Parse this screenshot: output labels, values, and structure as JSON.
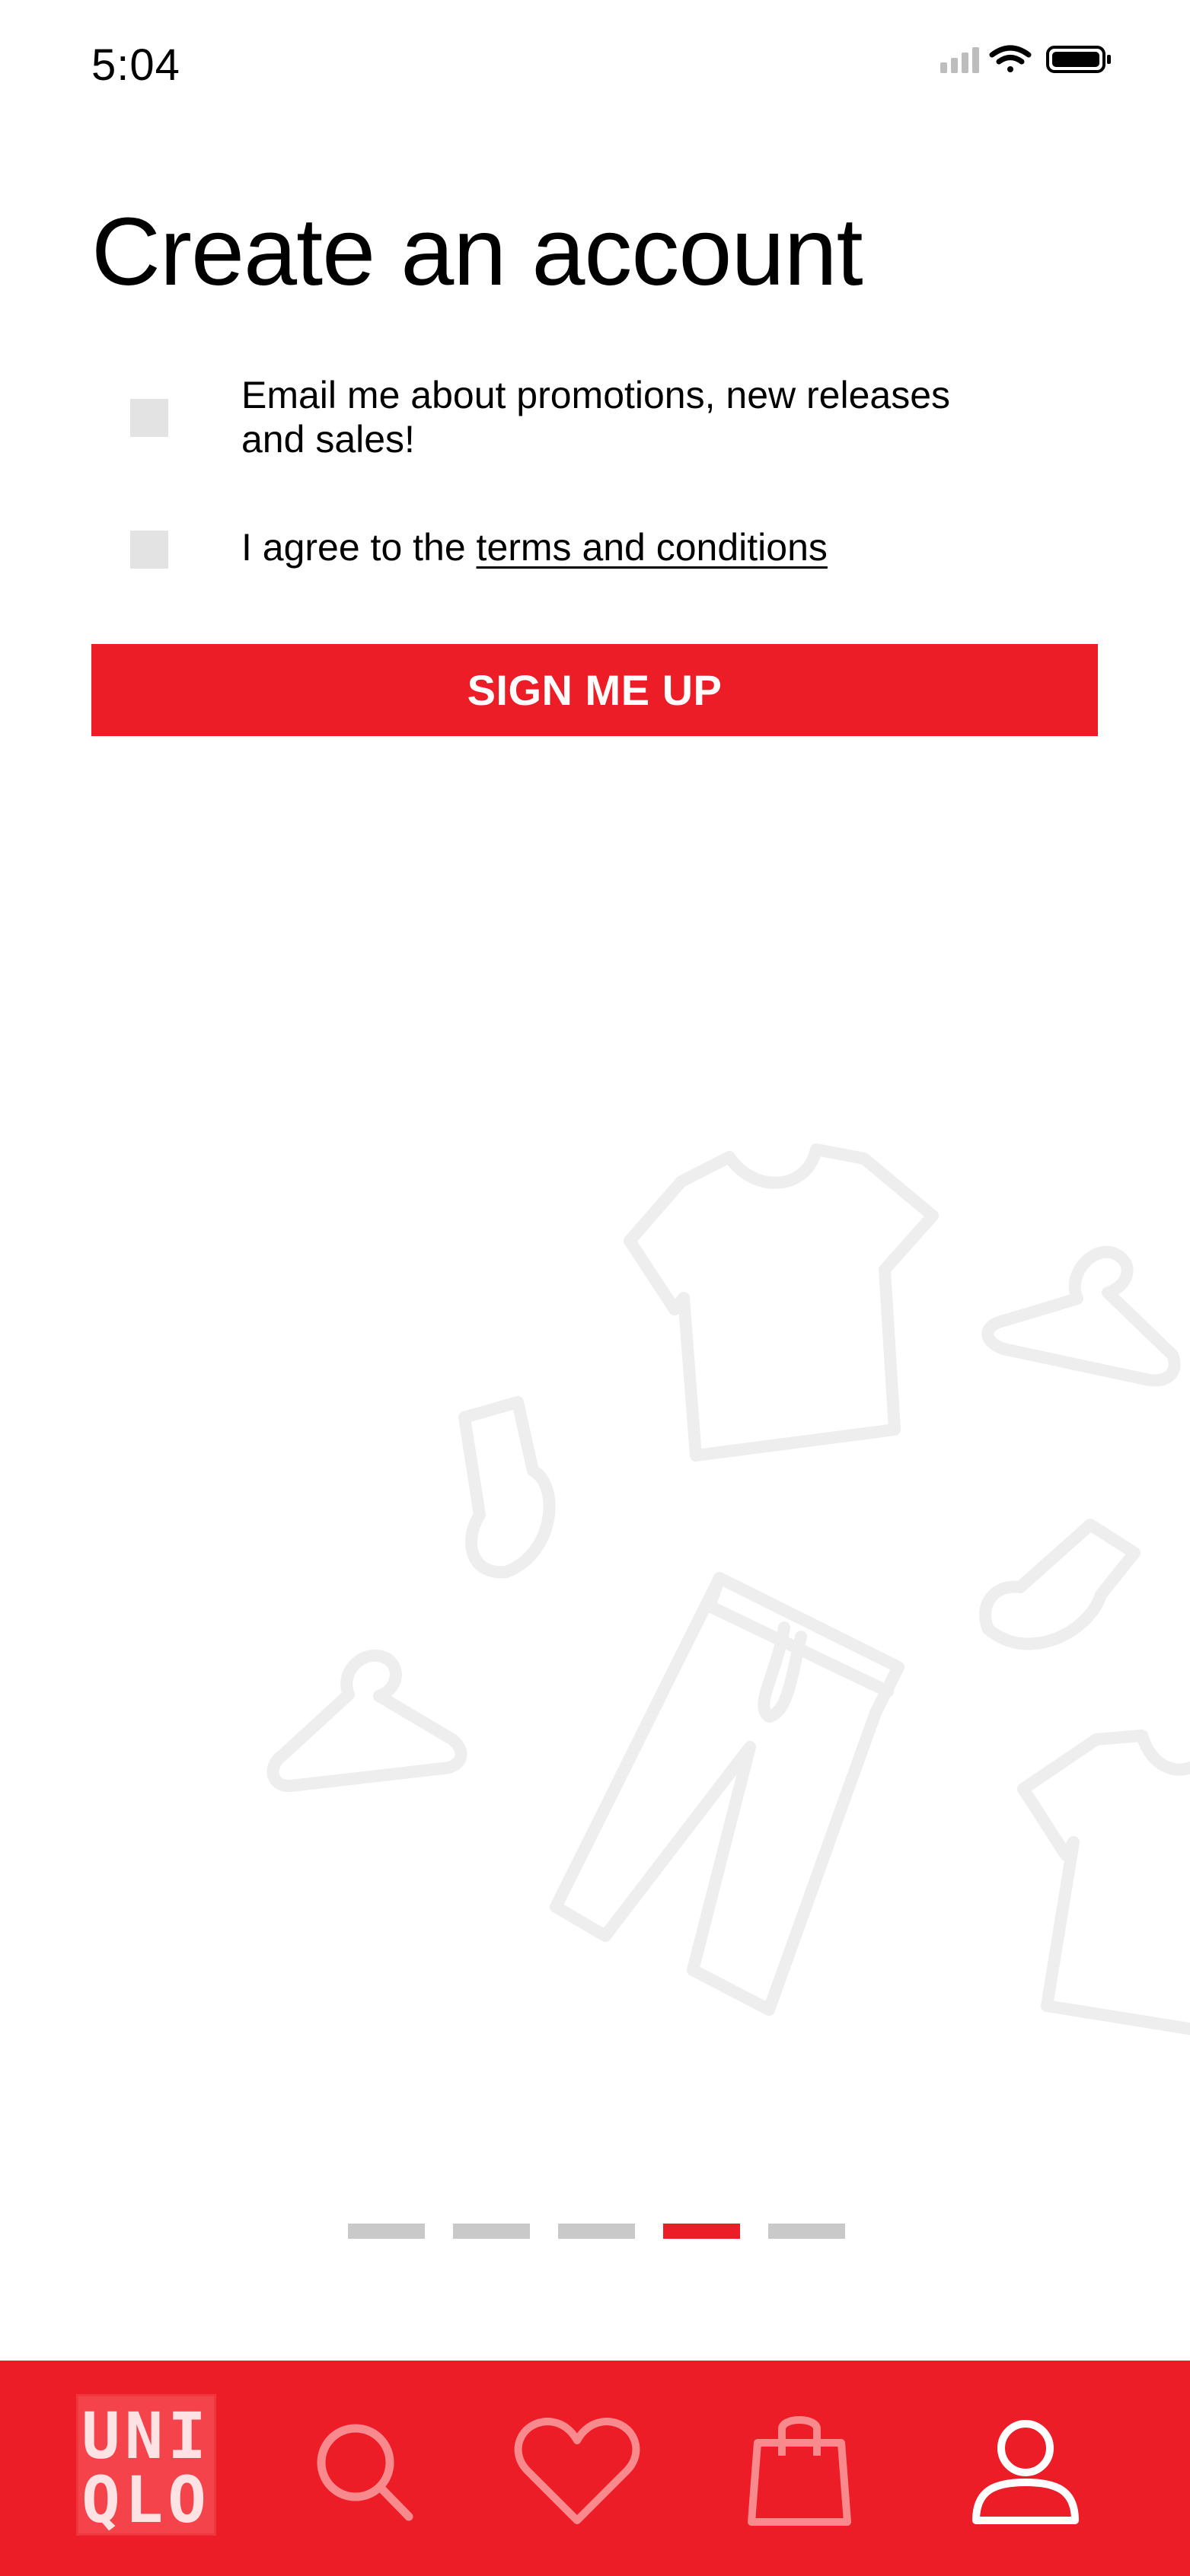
{
  "status_bar": {
    "time": "5:04",
    "icons": [
      "signal-icon",
      "wifi-icon",
      "battery-icon"
    ]
  },
  "page": {
    "title": "Create an account"
  },
  "options": {
    "promotions": {
      "label_line1": "Email me about promotions, new releases",
      "label_line2": "and sales!",
      "checked": false
    },
    "terms": {
      "label_prefix": "I agree to the ",
      "link_text": "terms and conditions",
      "checked": false
    }
  },
  "actions": {
    "signup_label": "SIGN ME UP"
  },
  "pager": {
    "count": 5,
    "active_index": 3
  },
  "bottom_nav": {
    "logo_line1": "UNI",
    "logo_line2": "QLO",
    "items": [
      "search-icon",
      "heart-icon",
      "shopping-bag-icon",
      "profile-icon"
    ],
    "active_item": "profile-icon"
  },
  "colors": {
    "brand_red": "#ed1d27",
    "checkbox_bg": "#e3e3e3",
    "pager_inactive": "#c9c9c9",
    "illustration_stroke": "#eeeeee"
  }
}
